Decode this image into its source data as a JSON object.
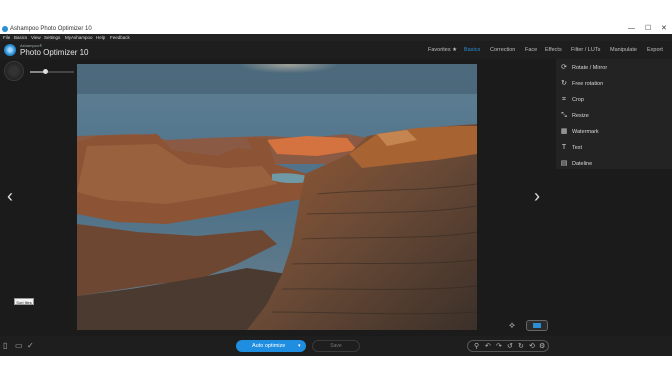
{
  "window": {
    "title": "Ashampoo Photo Optimizer 10",
    "controls": {
      "minimize": "—",
      "maximize": "☐",
      "close": "✕"
    }
  },
  "menu": [
    "File",
    "Basics",
    "View",
    "Settings",
    "MyAshampoo",
    "Help",
    "Feedback"
  ],
  "brand": {
    "small": "Ashampoo®",
    "name": "Photo Optimizer 10"
  },
  "nav": [
    {
      "label": "Favorites ★",
      "active": false
    },
    {
      "label": "Basics",
      "active": true
    },
    {
      "label": "Correction",
      "active": false
    },
    {
      "label": "Face",
      "active": false
    },
    {
      "label": "Effects",
      "active": false
    },
    {
      "label": "Filter / LUTs",
      "active": false
    },
    {
      "label": "Manipulate",
      "active": false
    },
    {
      "label": "Export",
      "active": false
    }
  ],
  "tools_panel": [
    {
      "icon": "rotate-mirror-icon",
      "glyph": "⟳",
      "label": "Rotate / Mirror"
    },
    {
      "icon": "free-rotation-icon",
      "glyph": "↻",
      "label": "Free rotation"
    },
    {
      "icon": "crop-icon",
      "glyph": "⌗",
      "label": "Crop"
    },
    {
      "icon": "resize-icon",
      "glyph": "⤡",
      "label": "Resize"
    },
    {
      "icon": "watermark-icon",
      "glyph": "▦",
      "label": "Watermark"
    },
    {
      "icon": "text-icon",
      "glyph": "T",
      "label": "Text"
    },
    {
      "icon": "dateline-icon",
      "glyph": "▤",
      "label": "Dateline"
    }
  ],
  "bottom": {
    "auto_optimize": "Auto optimize",
    "save": "Save",
    "tooltip": "Sort files"
  },
  "zoom_level": 0.35,
  "accent": "#2a8fd4"
}
